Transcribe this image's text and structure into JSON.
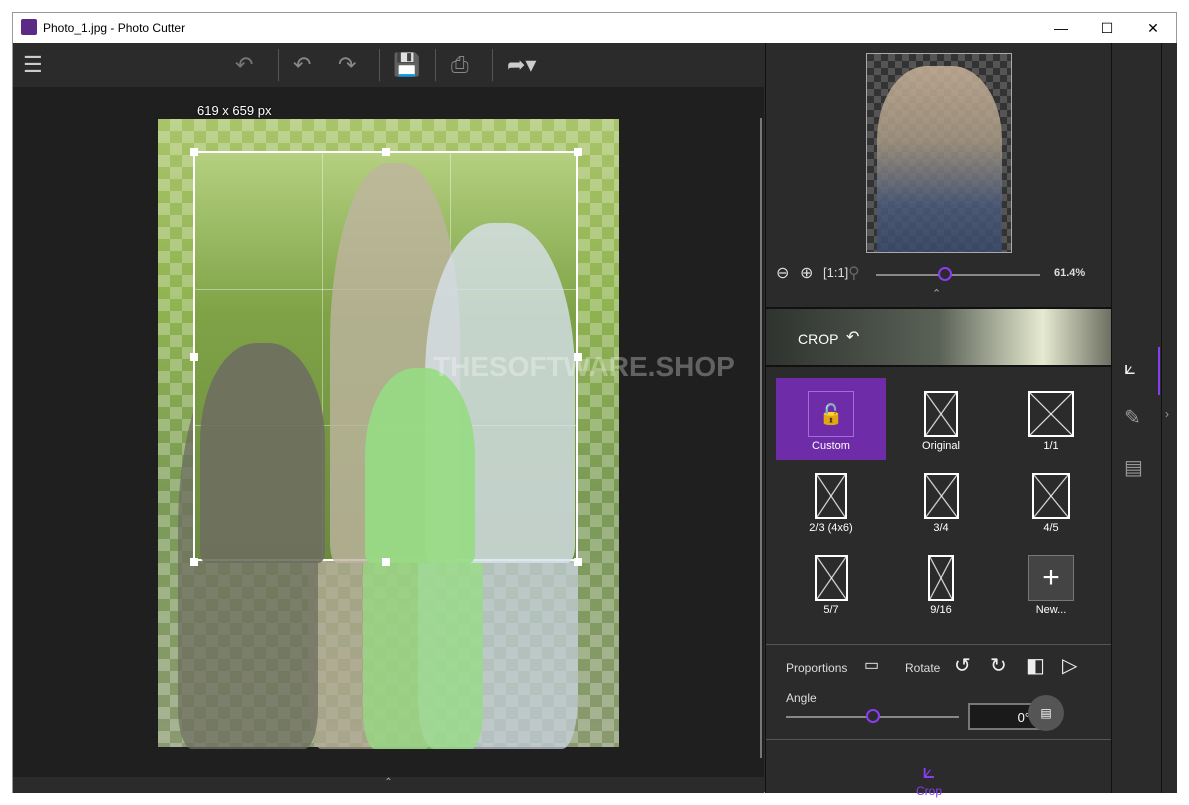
{
  "window": {
    "title": "Photo_1.jpg - Photo Cutter",
    "controls": [
      "minimize",
      "maximize",
      "close"
    ]
  },
  "toolbar": {
    "icons": [
      "menu-icon",
      "undo-all-icon",
      "undo-icon",
      "redo-icon",
      "save-icon",
      "print-icon",
      "share-icon"
    ]
  },
  "canvas": {
    "dimensions": "619 x 659 px",
    "watermark": "THESOFTWARE.SHOP"
  },
  "preview": {
    "zoom": "61.4%",
    "zoom_fraction": 0.42,
    "actual_size_label": "[1:1]"
  },
  "crop_section": {
    "title": "CROP"
  },
  "presets": [
    {
      "label": "Custom",
      "selected": true
    },
    {
      "label": "Original"
    },
    {
      "label": "1/1"
    },
    {
      "label": "2/3 (4x6)"
    },
    {
      "label": "3/4"
    },
    {
      "label": "4/5"
    },
    {
      "label": "5/7"
    },
    {
      "label": "9/16"
    },
    {
      "label": "New..."
    }
  ],
  "controls": {
    "proportions": "Proportions",
    "rotate": "Rotate",
    "angle": "Angle",
    "angle_value": "0°",
    "angle_fraction": 0.5
  },
  "bottom_tab": {
    "label": "Crop"
  },
  "colors": {
    "accent": "#8a3cf0",
    "selected": "#6f2ca9",
    "panel": "#2b2b2b"
  }
}
